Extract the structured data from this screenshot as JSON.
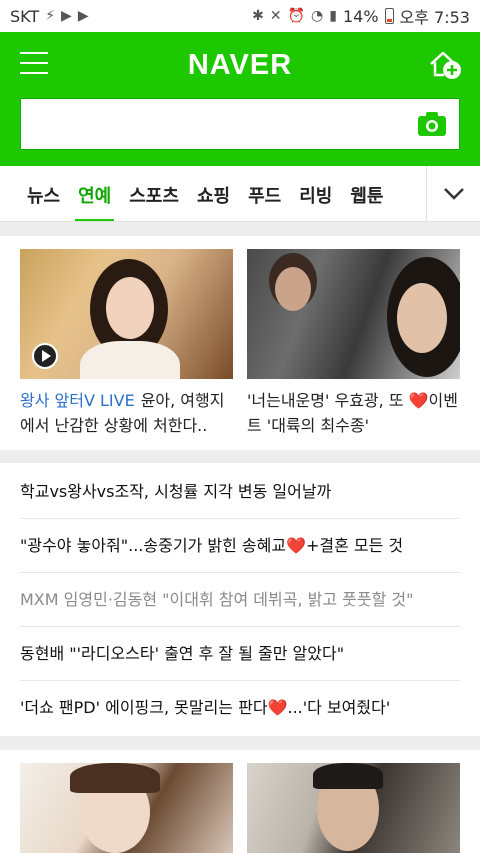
{
  "status_bar": {
    "carrier": "SKT",
    "battery": "14%",
    "time": "오후 7:53"
  },
  "header": {
    "logo": "NAVER",
    "search_placeholder": "",
    "brand_color": "#1ec800"
  },
  "tabs": {
    "items": [
      "뉴스",
      "연예",
      "스포츠",
      "쇼핑",
      "푸드",
      "리빙",
      "웹툰"
    ],
    "active_index": 1
  },
  "cards": [
    {
      "label": "왕사 앞터V LIVE",
      "text": "윤아, 여행지에서 난감한 상황에 처한다..",
      "has_video": true
    },
    {
      "label": "",
      "text": "'너는내운명' 우효광, 또 ❤️이벤트 '대륙의 최수종'",
      "has_video": false
    }
  ],
  "headlines": [
    {
      "text": "학교vs왕사vs조작, 시청률 지각 변동 일어날까",
      "visited": false
    },
    {
      "text": "\"광수야 놓아줘\"...송중기가 밝힌 송혜교❤️+결혼 모든 것",
      "visited": false
    },
    {
      "text": "MXM 임영민·김동현 \"이대휘 참여 데뷔곡, 밝고 풋풋할 것\"",
      "visited": true
    },
    {
      "text": "동현배 \"'라디오스타' 출연 후 잘 될 줄만 알았다\"",
      "visited": false
    },
    {
      "text": "'더쇼 팬PD' 에이핑크, 못말리는 판다❤️...'다 보여줬다'",
      "visited": false
    }
  ]
}
